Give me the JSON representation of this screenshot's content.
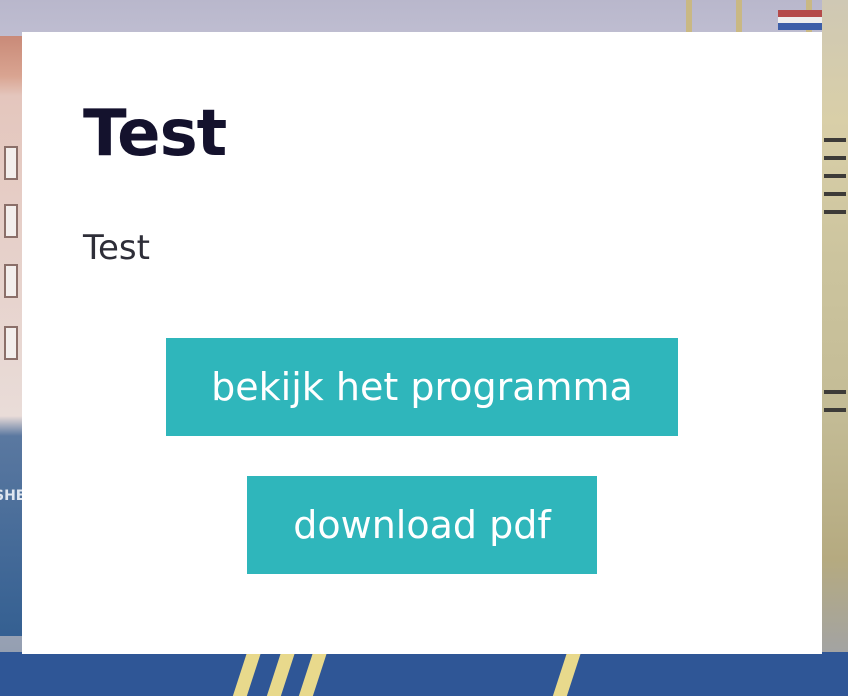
{
  "card": {
    "title": "Test",
    "body_text": "Test",
    "buttons": {
      "program_label": "bekijk het programma",
      "pdf_label": "download pdf"
    }
  },
  "background": {
    "description_icon": "harbor-photo",
    "hull_label_fragment": "SHE"
  },
  "colors": {
    "button_bg": "#2fb6bb",
    "button_text": "#ffffff",
    "title_text": "#14122d",
    "body_text": "#2e2e38",
    "card_bg": "#ffffff"
  }
}
